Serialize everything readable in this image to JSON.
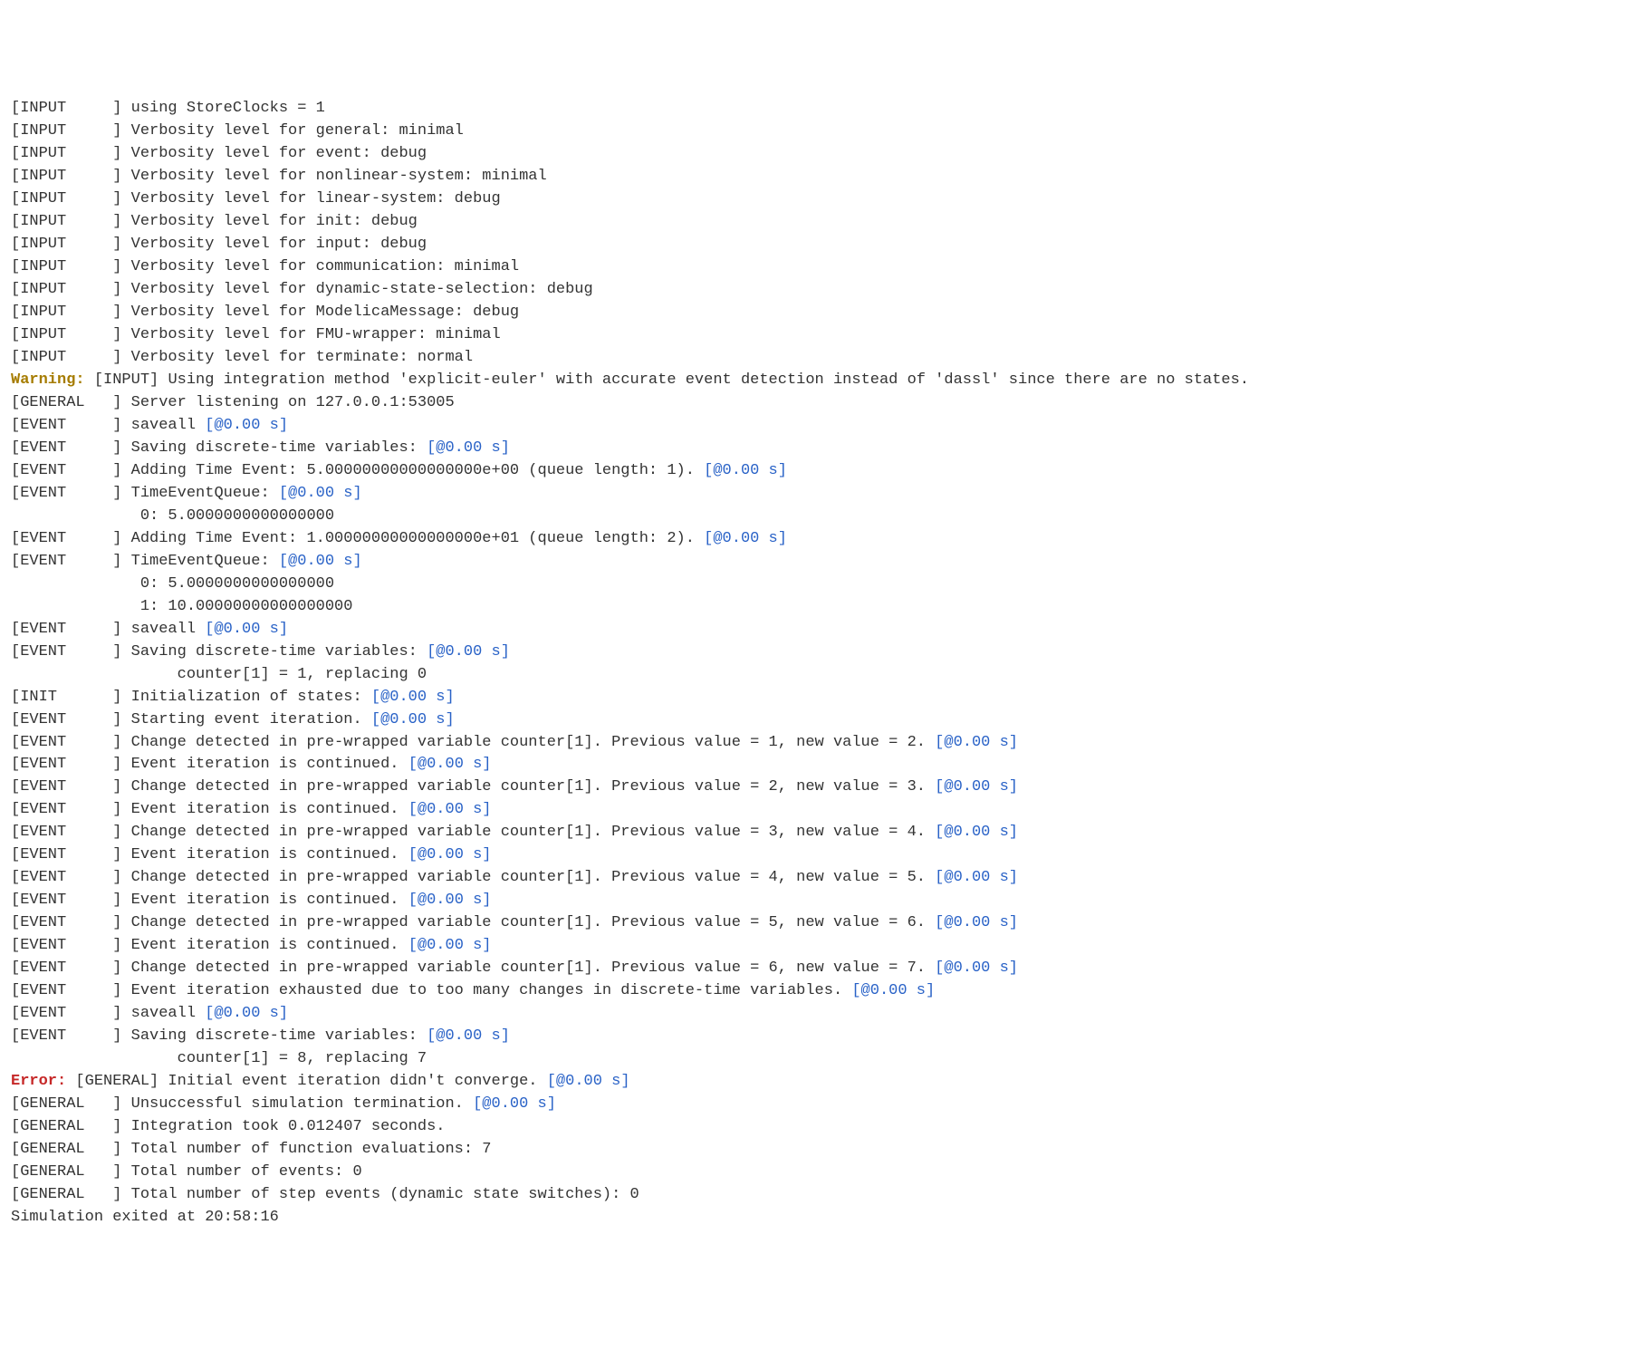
{
  "lines": [
    {
      "type": "tagged",
      "tag": "[INPUT     ]",
      "msg": " using StoreClocks = 1"
    },
    {
      "type": "tagged",
      "tag": "[INPUT     ]",
      "msg": " Verbosity level for general: minimal"
    },
    {
      "type": "tagged",
      "tag": "[INPUT     ]",
      "msg": " Verbosity level for event: debug"
    },
    {
      "type": "tagged",
      "tag": "[INPUT     ]",
      "msg": " Verbosity level for nonlinear-system: minimal"
    },
    {
      "type": "tagged",
      "tag": "[INPUT     ]",
      "msg": " Verbosity level for linear-system: debug"
    },
    {
      "type": "tagged",
      "tag": "[INPUT     ]",
      "msg": " Verbosity level for init: debug"
    },
    {
      "type": "tagged",
      "tag": "[INPUT     ]",
      "msg": " Verbosity level for input: debug"
    },
    {
      "type": "tagged",
      "tag": "[INPUT     ]",
      "msg": " Verbosity level for communication: minimal"
    },
    {
      "type": "tagged",
      "tag": "[INPUT     ]",
      "msg": " Verbosity level for dynamic-state-selection: debug"
    },
    {
      "type": "tagged",
      "tag": "[INPUT     ]",
      "msg": " Verbosity level for ModelicaMessage: debug"
    },
    {
      "type": "tagged",
      "tag": "[INPUT     ]",
      "msg": " Verbosity level for FMU-wrapper: minimal"
    },
    {
      "type": "tagged",
      "tag": "[INPUT     ]",
      "msg": " Verbosity level for terminate: normal"
    },
    {
      "type": "warning",
      "label": "Warning:",
      "msg": " [INPUT] Using integration method 'explicit-euler' with accurate event detection instead of 'dassl' since there are no states."
    },
    {
      "type": "tagged",
      "tag": "[GENERAL   ]",
      "msg": " Server listening on 127.0.0.1:53005"
    },
    {
      "type": "tagged_ts",
      "tag": "[EVENT     ]",
      "msg": " saveall ",
      "ts": "[@0.00 s]"
    },
    {
      "type": "tagged_ts",
      "tag": "[EVENT     ]",
      "msg": " Saving discrete-time variables: ",
      "ts": "[@0.00 s]"
    },
    {
      "type": "tagged_ts",
      "tag": "[EVENT     ]",
      "msg": " Adding Time Event: 5.00000000000000000e+00 (queue length: 1). ",
      "ts": "[@0.00 s]"
    },
    {
      "type": "tagged_ts",
      "tag": "[EVENT     ]",
      "msg": " TimeEventQueue: ",
      "ts": "[@0.00 s]"
    },
    {
      "type": "plain",
      "msg": "              0: 5.0000000000000000"
    },
    {
      "type": "tagged_ts",
      "tag": "[EVENT     ]",
      "msg": " Adding Time Event: 1.00000000000000000e+01 (queue length: 2). ",
      "ts": "[@0.00 s]"
    },
    {
      "type": "tagged_ts",
      "tag": "[EVENT     ]",
      "msg": " TimeEventQueue: ",
      "ts": "[@0.00 s]"
    },
    {
      "type": "plain",
      "msg": "              0: 5.0000000000000000"
    },
    {
      "type": "plain",
      "msg": "              1: 10.00000000000000000"
    },
    {
      "type": "tagged_ts",
      "tag": "[EVENT     ]",
      "msg": " saveall ",
      "ts": "[@0.00 s]"
    },
    {
      "type": "tagged_ts",
      "tag": "[EVENT     ]",
      "msg": " Saving discrete-time variables: ",
      "ts": "[@0.00 s]"
    },
    {
      "type": "plain",
      "msg": "                  counter[1] = 1, replacing 0"
    },
    {
      "type": "tagged_ts",
      "tag": "[INIT      ]",
      "msg": " Initialization of states: ",
      "ts": "[@0.00 s]"
    },
    {
      "type": "tagged_ts",
      "tag": "[EVENT     ]",
      "msg": " Starting event iteration. ",
      "ts": "[@0.00 s]"
    },
    {
      "type": "tagged_ts",
      "tag": "[EVENT     ]",
      "msg": " Change detected in pre-wrapped variable counter[1]. Previous value = 1, new value = 2. ",
      "ts": "[@0.00 s]"
    },
    {
      "type": "tagged_ts",
      "tag": "[EVENT     ]",
      "msg": " Event iteration is continued. ",
      "ts": "[@0.00 s]"
    },
    {
      "type": "tagged_ts",
      "tag": "[EVENT     ]",
      "msg": " Change detected in pre-wrapped variable counter[1]. Previous value = 2, new value = 3. ",
      "ts": "[@0.00 s]"
    },
    {
      "type": "tagged_ts",
      "tag": "[EVENT     ]",
      "msg": " Event iteration is continued. ",
      "ts": "[@0.00 s]"
    },
    {
      "type": "tagged_ts",
      "tag": "[EVENT     ]",
      "msg": " Change detected in pre-wrapped variable counter[1]. Previous value = 3, new value = 4. ",
      "ts": "[@0.00 s]"
    },
    {
      "type": "tagged_ts",
      "tag": "[EVENT     ]",
      "msg": " Event iteration is continued. ",
      "ts": "[@0.00 s]"
    },
    {
      "type": "tagged_ts",
      "tag": "[EVENT     ]",
      "msg": " Change detected in pre-wrapped variable counter[1]. Previous value = 4, new value = 5. ",
      "ts": "[@0.00 s]"
    },
    {
      "type": "tagged_ts",
      "tag": "[EVENT     ]",
      "msg": " Event iteration is continued. ",
      "ts": "[@0.00 s]"
    },
    {
      "type": "tagged_ts",
      "tag": "[EVENT     ]",
      "msg": " Change detected in pre-wrapped variable counter[1]. Previous value = 5, new value = 6. ",
      "ts": "[@0.00 s]"
    },
    {
      "type": "tagged_ts",
      "tag": "[EVENT     ]",
      "msg": " Event iteration is continued. ",
      "ts": "[@0.00 s]"
    },
    {
      "type": "tagged_ts",
      "tag": "[EVENT     ]",
      "msg": " Change detected in pre-wrapped variable counter[1]. Previous value = 6, new value = 7. ",
      "ts": "[@0.00 s]"
    },
    {
      "type": "tagged_ts",
      "tag": "[EVENT     ]",
      "msg": " Event iteration exhausted due to too many changes in discrete-time variables. ",
      "ts": "[@0.00 s]"
    },
    {
      "type": "tagged_ts",
      "tag": "[EVENT     ]",
      "msg": " saveall ",
      "ts": "[@0.00 s]"
    },
    {
      "type": "tagged_ts",
      "tag": "[EVENT     ]",
      "msg": " Saving discrete-time variables: ",
      "ts": "[@0.00 s]"
    },
    {
      "type": "plain",
      "msg": "                  counter[1] = 8, replacing 7"
    },
    {
      "type": "error",
      "label": "Error:",
      "msg": " [GENERAL] Initial event iteration didn't converge. ",
      "ts": "[@0.00 s]"
    },
    {
      "type": "tagged_ts",
      "tag": "[GENERAL   ]",
      "msg": " Unsuccessful simulation termination. ",
      "ts": "[@0.00 s]"
    },
    {
      "type": "tagged",
      "tag": "[GENERAL   ]",
      "msg": " Integration took 0.012407 seconds."
    },
    {
      "type": "tagged",
      "tag": "[GENERAL   ]",
      "msg": " Total number of function evaluations: 7"
    },
    {
      "type": "tagged",
      "tag": "[GENERAL   ]",
      "msg": " Total number of events: 0"
    },
    {
      "type": "tagged",
      "tag": "[GENERAL   ]",
      "msg": " Total number of step events (dynamic state switches): 0"
    },
    {
      "type": "plain",
      "msg": "Simulation exited at 20:58:16"
    }
  ]
}
